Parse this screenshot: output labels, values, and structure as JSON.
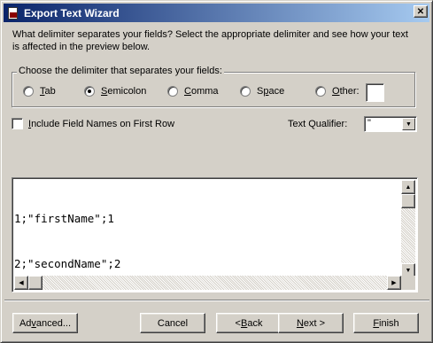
{
  "window": {
    "title": "Export Text Wizard",
    "close_label": "✕"
  },
  "prompt": {
    "line1": "What delimiter separates your fields? Select the appropriate delimiter and see how your text",
    "line2": "is affected in the preview below."
  },
  "delimiter_group": {
    "legend": "Choose the delimiter that separates your fields:",
    "options": [
      {
        "pre": "",
        "key": "T",
        "post": "ab",
        "checked": false
      },
      {
        "pre": "",
        "key": "S",
        "post": "emicolon",
        "checked": true
      },
      {
        "pre": "",
        "key": "C",
        "post": "omma",
        "checked": false
      },
      {
        "pre": "S",
        "key": "p",
        "post": "ace",
        "checked": false
      },
      {
        "pre": "",
        "key": "O",
        "post": "ther:",
        "checked": false
      }
    ],
    "other_value": ""
  },
  "include_field_names": {
    "key": "I",
    "label": "nclude Field Names on First Row",
    "checked": false
  },
  "text_qualifier": {
    "label": "Text Qualifier:",
    "value": "\""
  },
  "preview": {
    "lines": [
      "1;\"firstName\";1",
      "2;\"secondName\";2"
    ]
  },
  "buttons": {
    "advanced": {
      "pre": "Ad",
      "key": "v",
      "post": "anced..."
    },
    "cancel": {
      "pre": "",
      "key": "",
      "post": "Cancel"
    },
    "back": {
      "pre": "< ",
      "key": "B",
      "post": "ack"
    },
    "next": {
      "pre": "",
      "key": "N",
      "post": "ext >"
    },
    "finish": {
      "pre": "",
      "key": "F",
      "post": "inish"
    }
  }
}
